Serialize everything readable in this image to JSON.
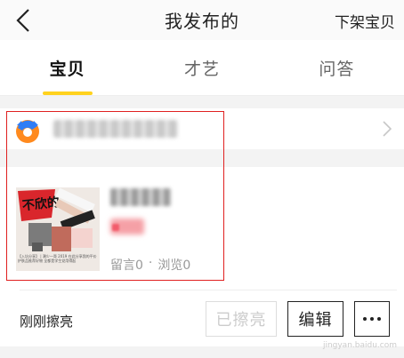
{
  "navbar": {
    "title": "我发布的",
    "right_action": "下架宝贝",
    "back_icon": "chevron-left-icon"
  },
  "tabs": [
    {
      "label": "宝贝",
      "active": true
    },
    {
      "label": "才艺",
      "active": false
    },
    {
      "label": "问答",
      "active": false
    }
  ],
  "shop": {
    "logo_icon": "shop-logo-icon",
    "arrow_icon": "chevron-right-icon"
  },
  "item": {
    "thumb_label": "不欣的",
    "thumb_caption": "【入坑分享】 | 潮少一哥 2019 在此分享我的平价护肤品推荐好物 全都是学生党用得起",
    "comments": "留言0",
    "separator": "·",
    "views": "浏览0"
  },
  "footer": {
    "status": "刚刚擦亮",
    "polished_button": "已擦亮",
    "edit_button": "编辑",
    "more_icon": "more-dots-icon"
  },
  "colors": {
    "accent": "#ffd21e",
    "highlight_box": "#e02020",
    "price": "#f25c6b"
  },
  "watermark": "jingyan.baidu.com"
}
